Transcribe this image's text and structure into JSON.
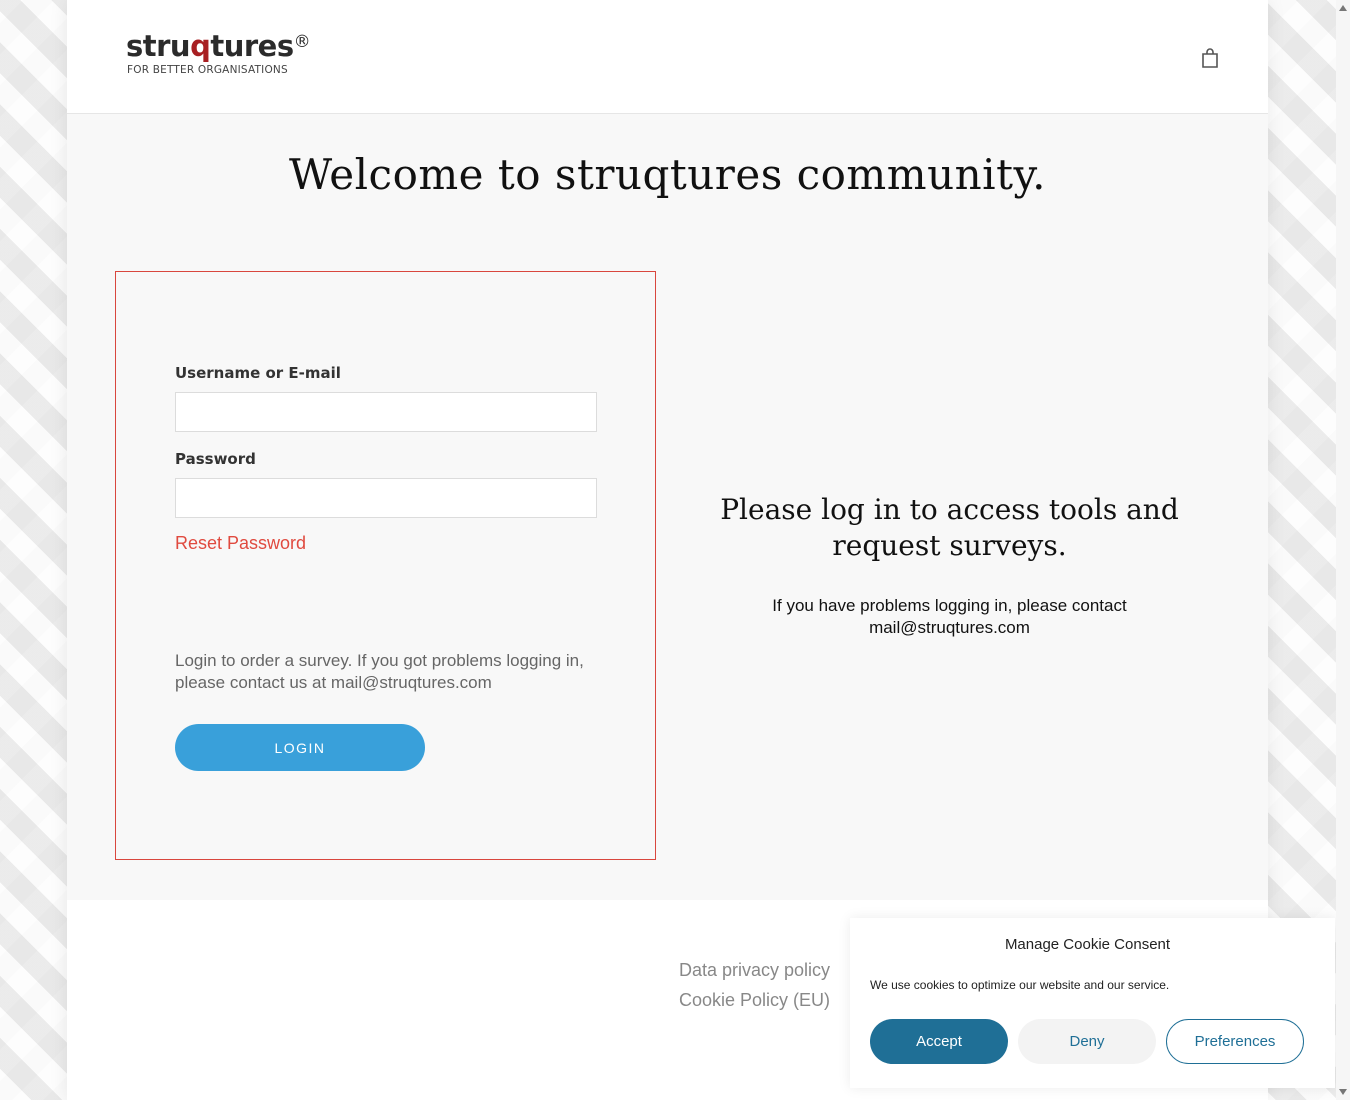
{
  "header": {
    "logo": {
      "word_a": "stru",
      "word_q": "q",
      "word_b": "tures",
      "reg": "®",
      "tagline": "FOR BETTER ORGANISATIONS"
    }
  },
  "hero": {
    "title": "Welcome to struqtures community."
  },
  "login": {
    "username_label": "Username or E-mail",
    "username_value": "",
    "password_label": "Password",
    "password_value": "",
    "reset_link": "Reset Password",
    "note": "Login to order a survey. If you got problems logging in, please contact us at mail@struqtures.com",
    "button": "LOGIN"
  },
  "info": {
    "title": "Please log in to access tools and request surveys.",
    "text": "If you have problems logging in, please contact mail@struqtures.com"
  },
  "footer": {
    "links": [
      "Data privacy policy",
      "Cookie Policy (EU)"
    ]
  },
  "cookie": {
    "title": "Manage Cookie Consent",
    "text": "We use cookies to optimize our website and our service.",
    "accept": "Accept",
    "deny": "Deny",
    "preferences": "Preferences"
  },
  "icons": {
    "cart": "shopping-bag-icon"
  },
  "colors": {
    "accent": "#39a0da",
    "logo_red": "#a81f22",
    "box_border": "#d9473e",
    "cookie_blue": "#1f6f96"
  }
}
